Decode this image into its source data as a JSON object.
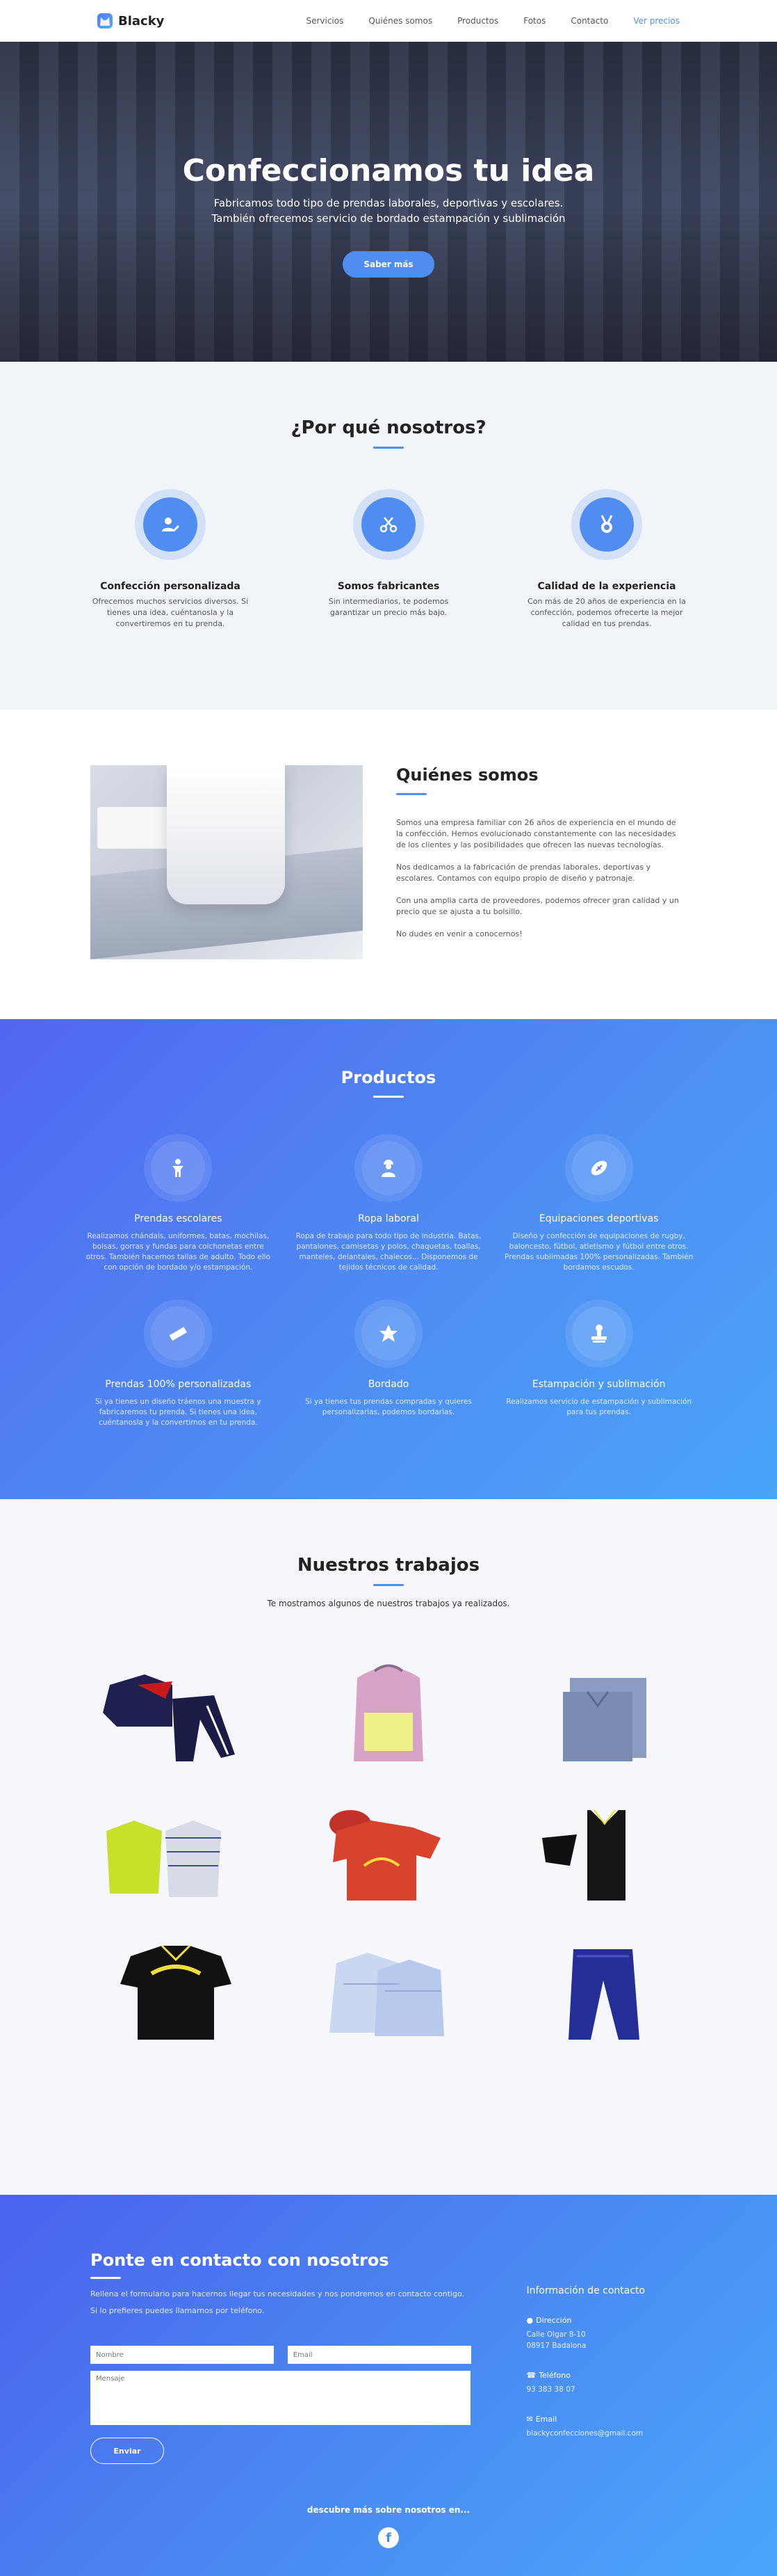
{
  "nav": {
    "brand": "Blacky",
    "items": [
      "Servicios",
      "Quiénes somos",
      "Productos",
      "Fotos",
      "Contacto",
      "Ver precios"
    ]
  },
  "hero": {
    "title": "Confeccionamos tu idea",
    "line1": "Fabricamos todo tipo de prendas laborales, deportivas y escolares.",
    "line2": "También ofrecemos servicio de bordado estampación y sublimación",
    "button": "Saber más"
  },
  "why": {
    "title": "¿Por qué nosotros?",
    "items": [
      {
        "icon": "user-edit-icon",
        "title": "Confección personalizada",
        "text": "Ofrecemos muchos servicios diversos. Si tienes una idea, cuéntanosla y la convertiremos en tu prenda."
      },
      {
        "icon": "scissors-icon",
        "title": "Somos fabricantes",
        "text": "Sin intermediarios, te podemos garantizar un precio más bajo."
      },
      {
        "icon": "medal-icon",
        "title": "Calidad de la experiencia",
        "text": "Con más de 20 años de experiencia en la confección, podemos ofrecerte la mejor calidad en tus prendas."
      }
    ]
  },
  "about": {
    "title": "Quiénes somos",
    "p1": "Somos una empresa familiar con 26 años de experiencia en el mundo de la confección. Hemos evolucionado constantemente con las necesidades de los clientes y las posibilidades que ofrecen las nuevas tecnologías.",
    "p2": "Nos dedicamos a la fabricación de prendas laborales, deportivas y escolares. Contamos con equipo propio de diseño y patronaje.",
    "p3": "Con una amplia carta de proveedores, podemos ofrecer gran calidad y un precio que se ajusta a tu bolsillo.",
    "p4": "No dudes en venir a conocernos!"
  },
  "products": {
    "title": "Productos",
    "items": [
      {
        "icon": "child-icon",
        "title": "Prendas escolares",
        "text": "Realizamos chándals, uniformes, batas, mochilas, bolsas, gorras y fundas para colchonetas entre otros. También hacemos tallas de adulto. Todo ello con opción de bordado y/o estampación."
      },
      {
        "icon": "worker-icon",
        "title": "Ropa laboral",
        "text": "Ropa de trabajo para todo tipo de industria. Batas, pantalones, camisetas y polos, chaquetas, toallas, manteles, delantales, chalecos... Disponemos de tejidos técnicos de calidad."
      },
      {
        "icon": "football-icon",
        "title": "Equipaciones deportivas",
        "text": "Diseño y confección de equipaciones de rugby, baloncesto, fútbol, atletismo y fútbol entre otros. Prendas sublimadas 100% personalizadas. También bordamos escudos."
      },
      {
        "icon": "ruler-icon",
        "title": "Prendas 100% personalizadas",
        "text": "Si ya tienes un diseño tráenos una muestra y fabricaremos tu prenda. Si tienes una idea, cuéntanosla y la convertimos en tu prenda."
      },
      {
        "icon": "star-icon",
        "title": "Bordado",
        "text": "Si ya tienes tus prendas compradas y quieres personalizarlas, podemos bordarlas."
      },
      {
        "icon": "stamp-icon",
        "title": "Estampación y sublimación",
        "text": "Realizamos servicio de estampación y sublimación para tus prendas."
      }
    ]
  },
  "works": {
    "title": "Nuestros trabajos",
    "subtitle": "Te mostramos algunos de nuestros trabajos ya realizados."
  },
  "contact": {
    "title": "Ponte en contacto con nosotros",
    "desc1": "Rellena el formulario para hacernos llegar tus necesidades y nos pondremos en contacto contigo.",
    "desc2": "Si lo prefieres puedes llamarnos por teléfono.",
    "name_placeholder": "Nombre",
    "email_placeholder": "Email",
    "message_placeholder": "Mensaje",
    "send": "Enviar",
    "info_title": "Información de contacto",
    "address_label": "Dirección",
    "address": "Calle Olgar 8-10\n08917 Badalona",
    "phone_label": "Teléfono",
    "phone": "93 383 38 07",
    "email_label": "Email",
    "email": "blackyconfecciones@gmail.com"
  },
  "footer": {
    "text": "descubre más sobre nosotros en..."
  },
  "colors": {
    "accent": "#4f8df0",
    "gradient_start": "#5266f1",
    "gradient_end": "#4aa4f8"
  }
}
